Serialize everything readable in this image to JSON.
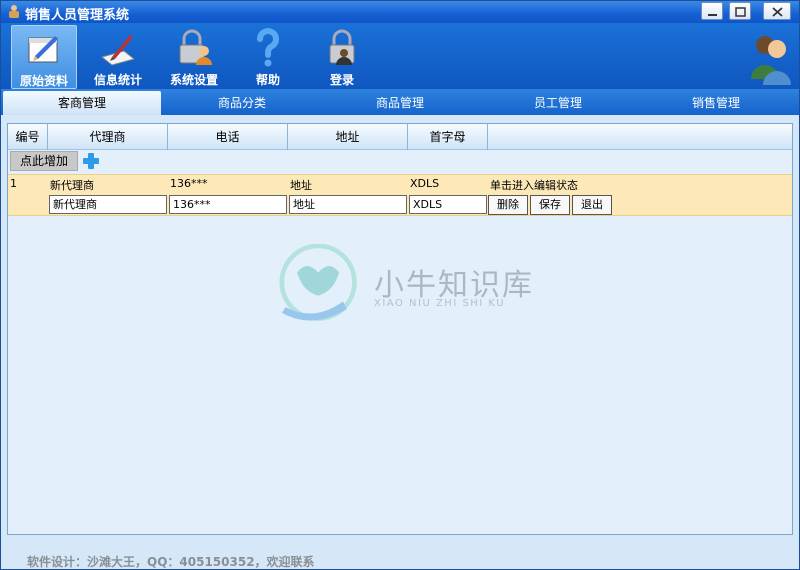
{
  "window": {
    "title": "销售人员管理系统",
    "controls": {
      "minimize": "—",
      "maximize": "□",
      "close": "✕"
    }
  },
  "toolbar": {
    "items": [
      {
        "label": "原始资料",
        "icon": "notebook-pen-icon",
        "active": true
      },
      {
        "label": "信息统计",
        "icon": "writing-pen-icon",
        "active": false
      },
      {
        "label": "系统设置",
        "icon": "lock-user-icon",
        "active": false
      },
      {
        "label": "帮助",
        "icon": "question-mark-icon",
        "active": false
      },
      {
        "label": "登录",
        "icon": "lock-login-icon",
        "active": false
      }
    ],
    "user_icon": "user-group-icon"
  },
  "tabs": [
    {
      "label": "客商管理",
      "active": true
    },
    {
      "label": "商品分类",
      "active": false
    },
    {
      "label": "商品管理",
      "active": false
    },
    {
      "label": "员工管理",
      "active": false
    },
    {
      "label": "销售管理",
      "active": false
    }
  ],
  "grid": {
    "columns": [
      "编号",
      "代理商",
      "电话",
      "地址",
      "首字母"
    ],
    "add_label": "点此增加",
    "row": {
      "id": "1",
      "agent": "新代理商",
      "phone": "136***",
      "address": "地址",
      "initials": "XDLS",
      "hint": "单击进入编辑状态"
    },
    "edit": {
      "agent": "新代理商",
      "phone": "136***",
      "address": "地址",
      "initials": "XDLS",
      "buttons": {
        "delete": "删除",
        "save": "保存",
        "exit": "退出"
      }
    }
  },
  "watermark": {
    "title": "小牛知识库",
    "subtitle": "XIAO NIU ZHI SHI KU"
  },
  "footer": {
    "text": "软件设计：沙滩大王，QQ：405150352，欢迎联系"
  },
  "colors": {
    "titlebar": "#1560d4",
    "toolbar": "#1463cb",
    "content_bg": "#e3f0fc",
    "row_highlight": "#fde8b8"
  }
}
